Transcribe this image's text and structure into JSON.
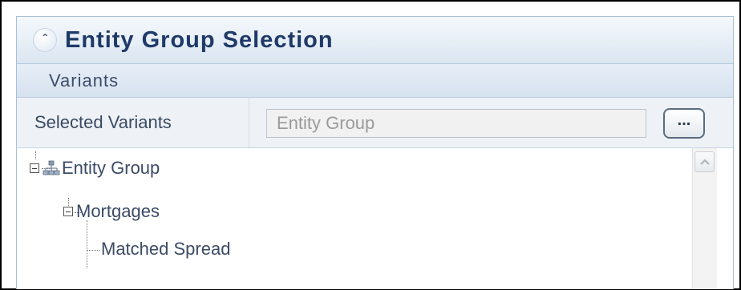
{
  "panel": {
    "title": "Entity Group Selection",
    "collapse_icon": "double-chevron-up-icon"
  },
  "variants": {
    "section_label": "Variants",
    "selected_label": "Selected Variants",
    "input_value": "Entity Group",
    "browse_label": "..."
  },
  "tree": {
    "root": {
      "label": "Entity Group",
      "icon": "hierarchy-icon"
    },
    "child": {
      "label": "Mortgages"
    },
    "leaf": {
      "label": "Matched Spread"
    }
  },
  "colors": {
    "title": "#1f3a68",
    "header_gradient_top": "#f4f8fc",
    "header_gradient_bottom": "#dbe6f1",
    "input_bg": "#f1f1f1"
  }
}
